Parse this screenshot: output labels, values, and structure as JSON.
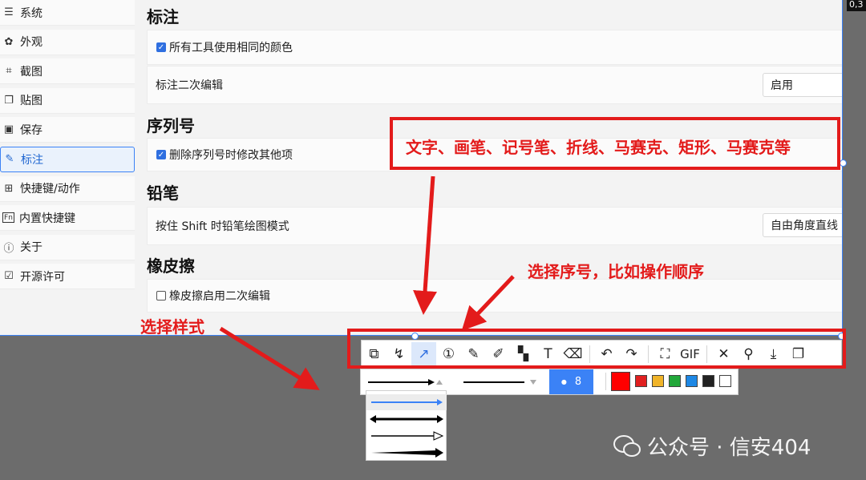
{
  "sidebar": {
    "items": [
      {
        "label": "系统",
        "icon": "sliders-icon",
        "glyph": "☰",
        "active": false
      },
      {
        "label": "外观",
        "icon": "palette-icon",
        "glyph": "✿",
        "active": false
      },
      {
        "label": "截图",
        "icon": "screenshot-icon",
        "glyph": "⌗",
        "active": false
      },
      {
        "label": "贴图",
        "icon": "pin-image-icon",
        "glyph": "❐",
        "active": false
      },
      {
        "label": "保存",
        "icon": "save-icon",
        "glyph": "▣",
        "active": false
      },
      {
        "label": "标注",
        "icon": "pencil-icon",
        "glyph": "✎",
        "active": true
      },
      {
        "label": "快捷键/动作",
        "icon": "keyboard-icon",
        "glyph": "⊞",
        "active": false
      },
      {
        "label": "内置快捷键",
        "icon": "fn-key-icon",
        "glyph": "Fn",
        "active": false
      },
      {
        "label": "关于",
        "icon": "info-icon",
        "glyph": "ⓘ",
        "active": false
      },
      {
        "label": "开源许可",
        "icon": "license-icon",
        "glyph": "☑",
        "active": false
      }
    ]
  },
  "sections": {
    "annotate_title": "标注",
    "same_color": "所有工具使用相同的颜色",
    "second_edit": "标注二次编辑",
    "second_edit_value": "启用",
    "serial_title": "序列号",
    "serial_delete": "删除序列号时修改其他项",
    "pencil_title": "铅笔",
    "shift_mode": "按住 Shift 时铅笔绘图模式",
    "shift_mode_value": "自由角度直线",
    "eraser_title": "橡皮擦",
    "eraser_edit": "橡皮擦启用二次编辑"
  },
  "corner_badge": "0,3",
  "toolbar": {
    "buttons": [
      {
        "name": "shape-tool-icon",
        "glyph": "⧉"
      },
      {
        "name": "polyline-tool-icon",
        "glyph": "↯"
      },
      {
        "name": "arrow-tool-icon",
        "glyph": "↗",
        "selected": true
      },
      {
        "name": "serial-number-tool-icon",
        "glyph": "①"
      },
      {
        "name": "pencil-tool-icon",
        "glyph": "✎"
      },
      {
        "name": "marker-tool-icon",
        "glyph": "✐"
      },
      {
        "name": "mosaic-tool-icon",
        "glyph": "▚"
      },
      {
        "name": "text-tool-icon",
        "glyph": "T"
      },
      {
        "name": "eraser-tool-icon",
        "glyph": "⌫"
      }
    ],
    "undo": "↶",
    "redo": "↷",
    "ocr": "⛶",
    "gif_label": "GIF",
    "close": "✕",
    "pin": "⚲",
    "download": "⤓",
    "copy": "❐"
  },
  "subbar": {
    "size_value": "8",
    "colors": [
      "#ff0000",
      "#e02020",
      "#f0b429",
      "#22a83a",
      "#1e88e5",
      "#222222",
      "#ffffff"
    ]
  },
  "annotations": {
    "top_text": "文字、画笔、记号笔、折线、马赛克、矩形、马赛克等",
    "middle_text": "选择序号，比如操作顺序",
    "left_text": "选择样式"
  },
  "watermark": "公众号 · 信安404"
}
